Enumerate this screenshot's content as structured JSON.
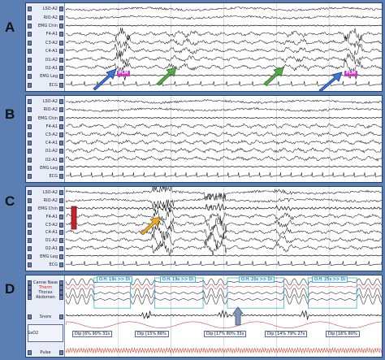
{
  "panels": [
    {
      "letter": "A",
      "channels": [
        "LSO-A2",
        "RIO-A2",
        "EMG Chin",
        "F4-A1",
        "C3-A2",
        "C4-A1",
        "O1-A2",
        "O2-A1",
        "EMG Leg",
        "ECG"
      ],
      "tags": [
        "PLM",
        "PLM"
      ]
    },
    {
      "letter": "B",
      "channels": [
        "LSO-A2",
        "RIO-A2",
        "EMG Chin",
        "F4-A1",
        "C3-A2",
        "C4-A1",
        "O1-A2",
        "O2-A1",
        "EMG Leg",
        "ECG"
      ],
      "tags": []
    },
    {
      "letter": "C",
      "channels": [
        "LSO-A2",
        "RIO-A2",
        "EMG Chin",
        "F4-A1",
        "C3-A2",
        "C4-A1",
        "O1-A2",
        "O2-A1",
        "EMG Leg",
        "ECG"
      ],
      "tags": []
    },
    {
      "letter": "D",
      "channels": [
        "Canne Nase",
        "Therm",
        "Thorax",
        "Abdomen",
        "Snore",
        "SaO2",
        "Pulse"
      ],
      "oh_tags": [
        "O.H. 19s >> Di",
        "O.H. 19s >> Di",
        "O.H. 20s >> Di",
        "O.H. 25s >> Di"
      ],
      "dip_tags": [
        "Dip [6%  90%  31s",
        "Dip [15%  86%",
        "Dip [17%  80%  33s",
        "Dip [14%  79%  27s",
        "Dip [16%  80%"
      ]
    }
  ],
  "colors": {
    "background": "#5b7fb2",
    "arrow_blue": "#3f74d8",
    "arrow_green": "#5aa84a",
    "arrow_red": "#c0262b",
    "arrow_yellow": "#e6ac2a",
    "arrow_grey": "#8595b6",
    "plm_tag": "#c63ac2",
    "therm": "#d21f1f"
  }
}
